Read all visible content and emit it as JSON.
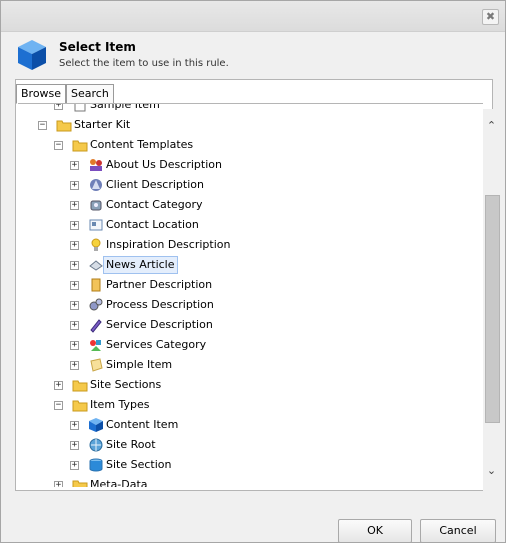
{
  "dialog": {
    "close_label": "✖",
    "title": "Select Item",
    "subtitle": "Select the item to use in this rule."
  },
  "tabs": [
    {
      "label": "Browse",
      "active": true
    },
    {
      "label": "Search",
      "active": false
    }
  ],
  "tree": [
    {
      "label": "Sample Item",
      "icon": "page-icon",
      "level": 2,
      "toggle": "+",
      "partial": true
    },
    {
      "label": "Starter Kit",
      "icon": "folder-icon",
      "level": 1,
      "toggle": "−"
    },
    {
      "label": "Content Templates",
      "icon": "folder-icon",
      "level": 2,
      "toggle": "−"
    },
    {
      "label": "About Us Description",
      "icon": "people-icon",
      "level": 3,
      "toggle": "+"
    },
    {
      "label": "Client Description",
      "icon": "client-icon",
      "level": 3,
      "toggle": "+"
    },
    {
      "label": "Contact Category",
      "icon": "phone-icon",
      "level": 3,
      "toggle": "+"
    },
    {
      "label": "Contact Location",
      "icon": "address-card-icon",
      "level": 3,
      "toggle": "+"
    },
    {
      "label": "Inspiration Description",
      "icon": "lightbulb-icon",
      "level": 3,
      "toggle": "+"
    },
    {
      "label": "News Article",
      "icon": "newspaper-icon",
      "level": 3,
      "toggle": "+",
      "selected": true
    },
    {
      "label": "Partner Description",
      "icon": "document-icon",
      "level": 3,
      "toggle": "+"
    },
    {
      "label": "Process Description",
      "icon": "gears-icon",
      "level": 3,
      "toggle": "+"
    },
    {
      "label": "Service Description",
      "icon": "tools-icon",
      "level": 3,
      "toggle": "+"
    },
    {
      "label": "Services Category",
      "icon": "shapes-icon",
      "level": 3,
      "toggle": "+"
    },
    {
      "label": "Simple Item",
      "icon": "note-icon",
      "level": 3,
      "toggle": "+"
    },
    {
      "label": "Site Sections",
      "icon": "folder-icon",
      "level": 2,
      "toggle": "+"
    },
    {
      "label": "Item Types",
      "icon": "folder-icon",
      "level": 2,
      "toggle": "−"
    },
    {
      "label": "Content Item",
      "icon": "blue-cube-icon",
      "level": 3,
      "toggle": "+"
    },
    {
      "label": "Site Root",
      "icon": "globe-icon",
      "level": 3,
      "toggle": "+"
    },
    {
      "label": "Site Section",
      "icon": "database-icon",
      "level": 3,
      "toggle": "+"
    },
    {
      "label": "Meta-Data",
      "icon": "folder-icon",
      "level": 2,
      "toggle": "+"
    }
  ],
  "scroll": {
    "up": "⌃",
    "down": "⌄",
    "position": 0.38
  },
  "buttons": {
    "ok": "OK",
    "cancel": "Cancel"
  },
  "colors": {
    "folder": "#f5c94a",
    "selection_bg": "#e4eefc",
    "selection_border": "#9fc1ef"
  }
}
